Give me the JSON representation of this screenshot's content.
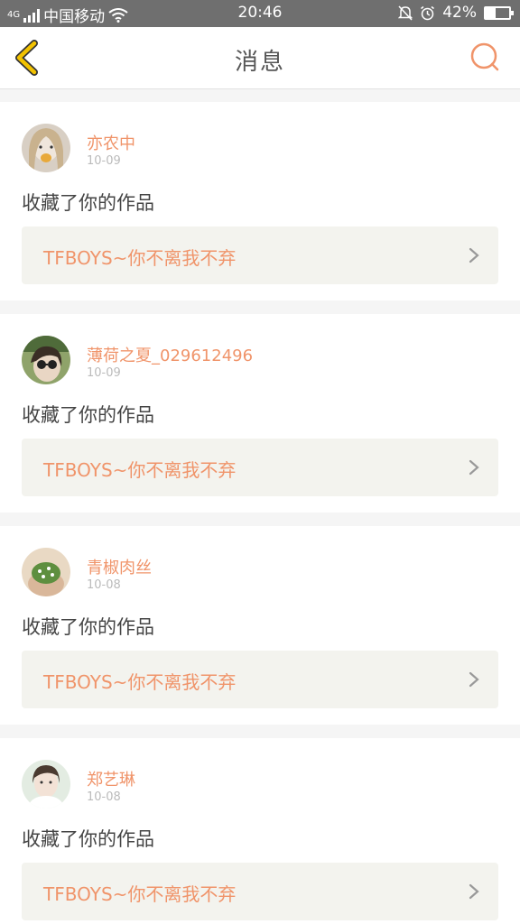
{
  "status_bar": {
    "network": "4G",
    "carrier": "中国移动",
    "time": "20:46",
    "battery": "42%",
    "battery_level": 0.42
  },
  "header": {
    "title": "消息",
    "back_icon": "chevron-left-icon",
    "search_icon": "search-icon"
  },
  "colors": {
    "accent_yellow": "#f2c200",
    "accent_orange": "#f0946a",
    "card_bg": "#f3f3ee",
    "page_bg": "#f5f5f5"
  },
  "messages": [
    {
      "user": "亦农中",
      "date": "10-09",
      "action": "收藏了你的作品",
      "work": "TFBOYS~你不离我不弃"
    },
    {
      "user": "薄荷之夏_029612496",
      "date": "10-09",
      "action": "收藏了你的作品",
      "work": "TFBOYS~你不离我不弃"
    },
    {
      "user": "青椒肉丝",
      "date": "10-08",
      "action": "收藏了你的作品",
      "work": "TFBOYS~你不离我不弃"
    },
    {
      "user": "郑艺琳",
      "date": "10-08",
      "action": "收藏了你的作品",
      "work": "TFBOYS~你不离我不弃"
    }
  ]
}
